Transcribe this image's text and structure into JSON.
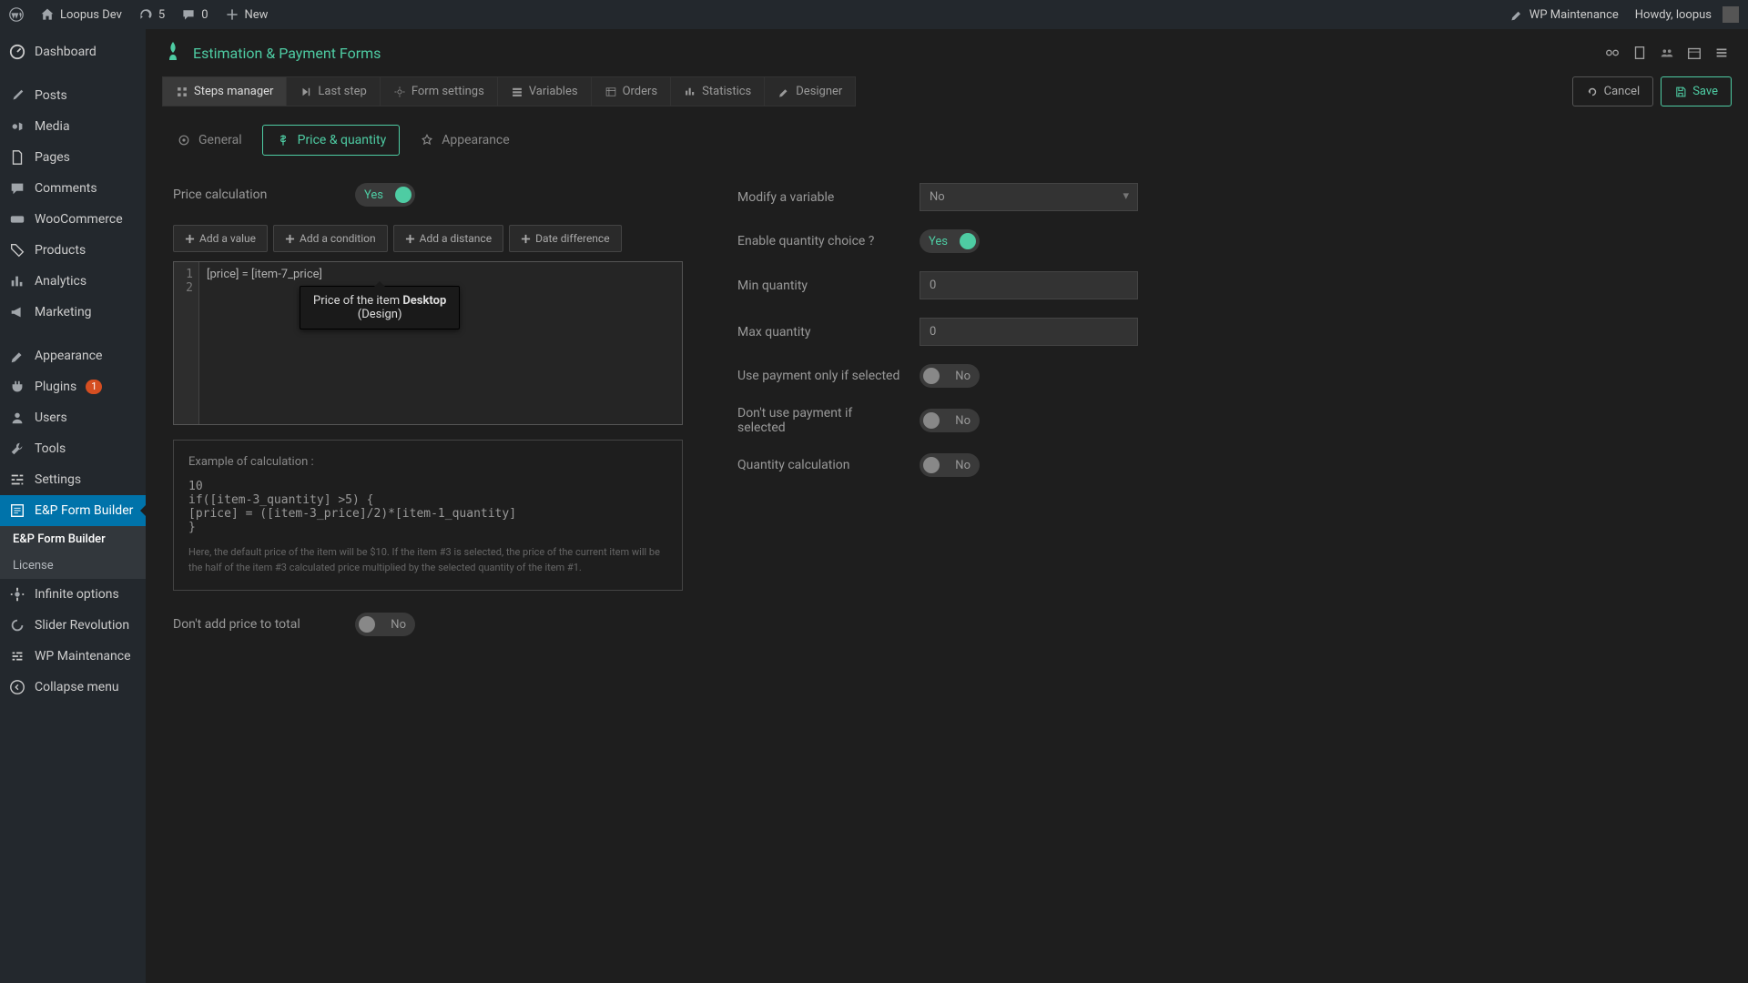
{
  "topbar": {
    "site": "Loopus Dev",
    "updates": "5",
    "comments": "0",
    "new": "New",
    "wpm": "WP Maintenance",
    "howdy": "Howdy, loopus"
  },
  "sidebar": {
    "dashboard": "Dashboard",
    "posts": "Posts",
    "media": "Media",
    "pages": "Pages",
    "comments": "Comments",
    "woo": "WooCommerce",
    "products": "Products",
    "analytics": "Analytics",
    "marketing": "Marketing",
    "appearance": "Appearance",
    "plugins": "Plugins",
    "plugins_badge": "1",
    "users": "Users",
    "tools": "Tools",
    "settings": "Settings",
    "epform": "E&P Form Builder",
    "epform_sub": "E&P Form Builder",
    "license": "License",
    "infinite": "Infinite options",
    "slider": "Slider Revolution",
    "wpm": "WP Maintenance",
    "collapse": "Collapse menu"
  },
  "header": {
    "title": "Estimation & Payment Forms"
  },
  "toolbar": {
    "steps": "Steps manager",
    "laststep": "Last step",
    "formsettings": "Form settings",
    "variables": "Variables",
    "orders": "Orders",
    "statistics": "Statistics",
    "designer": "Designer",
    "cancel": "Cancel",
    "save": "Save"
  },
  "tabs": {
    "general": "General",
    "price": "Price & quantity",
    "appearance": "Appearance"
  },
  "fields": {
    "price_calc": "Price calculation",
    "add_value": "Add a value",
    "add_condition": "Add a condition",
    "add_distance": "Add a distance",
    "date_diff": "Date difference",
    "code": "[price] = [item-7_price]",
    "tooltip_pre": "Price of the item ",
    "tooltip_bold": "Desktop",
    "tooltip_sub": "(Design)",
    "example_title": "Example of calculation :",
    "example_code": "10\nif([item-3_quantity] >5) {\n[price] = ([item-3_price]/2)*[item-1_quantity]\n}",
    "example_note": "Here, the default price of the item will be $10. If the item #3 is selected, the price of the current item will be the half of the item #3 calculated price multiplied by the selected quantity of the item #1.",
    "dont_add": "Don't add price to total",
    "modify_var": "Modify a variable",
    "modify_var_val": "No",
    "enable_qty": "Enable quantity choice ?",
    "min_qty": "Min quantity",
    "min_qty_val": "0",
    "max_qty": "Max quantity",
    "max_qty_val": "0",
    "use_payment": "Use payment only if selected",
    "dont_use_payment": "Don't use payment if selected",
    "qty_calc": "Quantity calculation",
    "yes": "Yes",
    "no": "No"
  }
}
